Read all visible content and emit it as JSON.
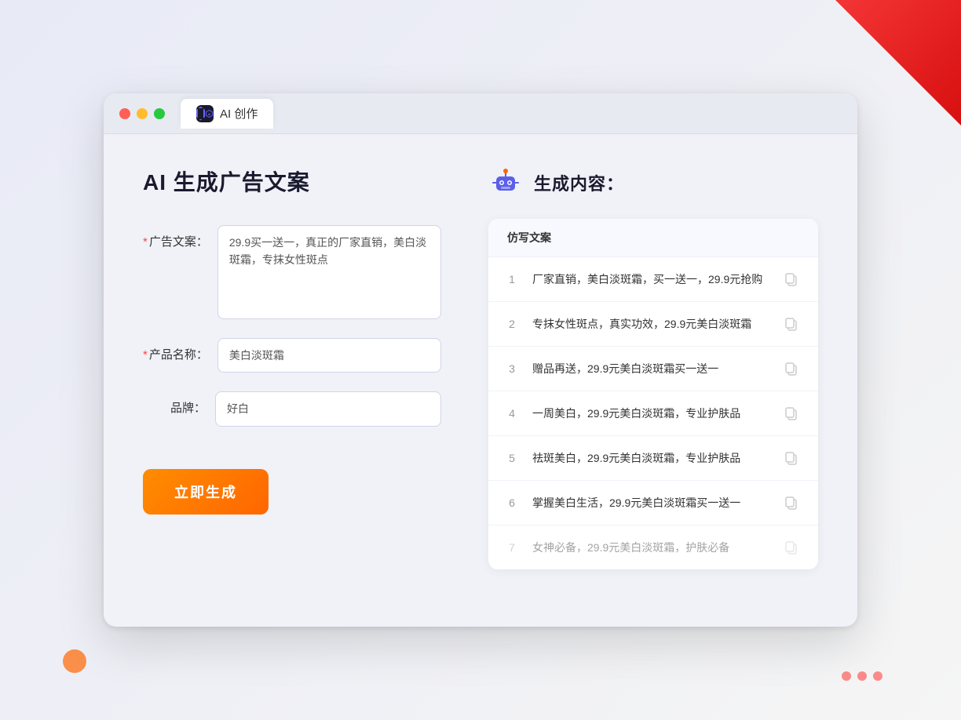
{
  "window": {
    "tab_label": "AI 创作"
  },
  "page": {
    "title": "AI 生成广告文案",
    "result_title": "生成内容："
  },
  "form": {
    "ad_label": "广告文案：",
    "ad_required": "*",
    "ad_value": "29.9买一送一，真正的厂家直销，美白淡斑霜，专抹女性斑点",
    "product_label": "产品名称：",
    "product_required": "*",
    "product_value": "美白淡斑霜",
    "brand_label": "品牌：",
    "brand_value": "好白",
    "generate_button": "立即生成"
  },
  "result": {
    "column_header": "仿写文案",
    "items": [
      {
        "num": "1",
        "text": "厂家直销，美白淡斑霜，买一送一，29.9元抢购"
      },
      {
        "num": "2",
        "text": "专抹女性斑点，真实功效，29.9元美白淡斑霜"
      },
      {
        "num": "3",
        "text": "赠品再送，29.9元美白淡斑霜买一送一"
      },
      {
        "num": "4",
        "text": "一周美白，29.9元美白淡斑霜，专业护肤品"
      },
      {
        "num": "5",
        "text": "祛斑美白，29.9元美白淡斑霜，专业护肤品"
      },
      {
        "num": "6",
        "text": "掌握美白生活，29.9元美白淡斑霜买一送一"
      },
      {
        "num": "7",
        "text": "女神必备，29.9元美白淡斑霜，护肤必备",
        "dimmed": true
      }
    ]
  }
}
